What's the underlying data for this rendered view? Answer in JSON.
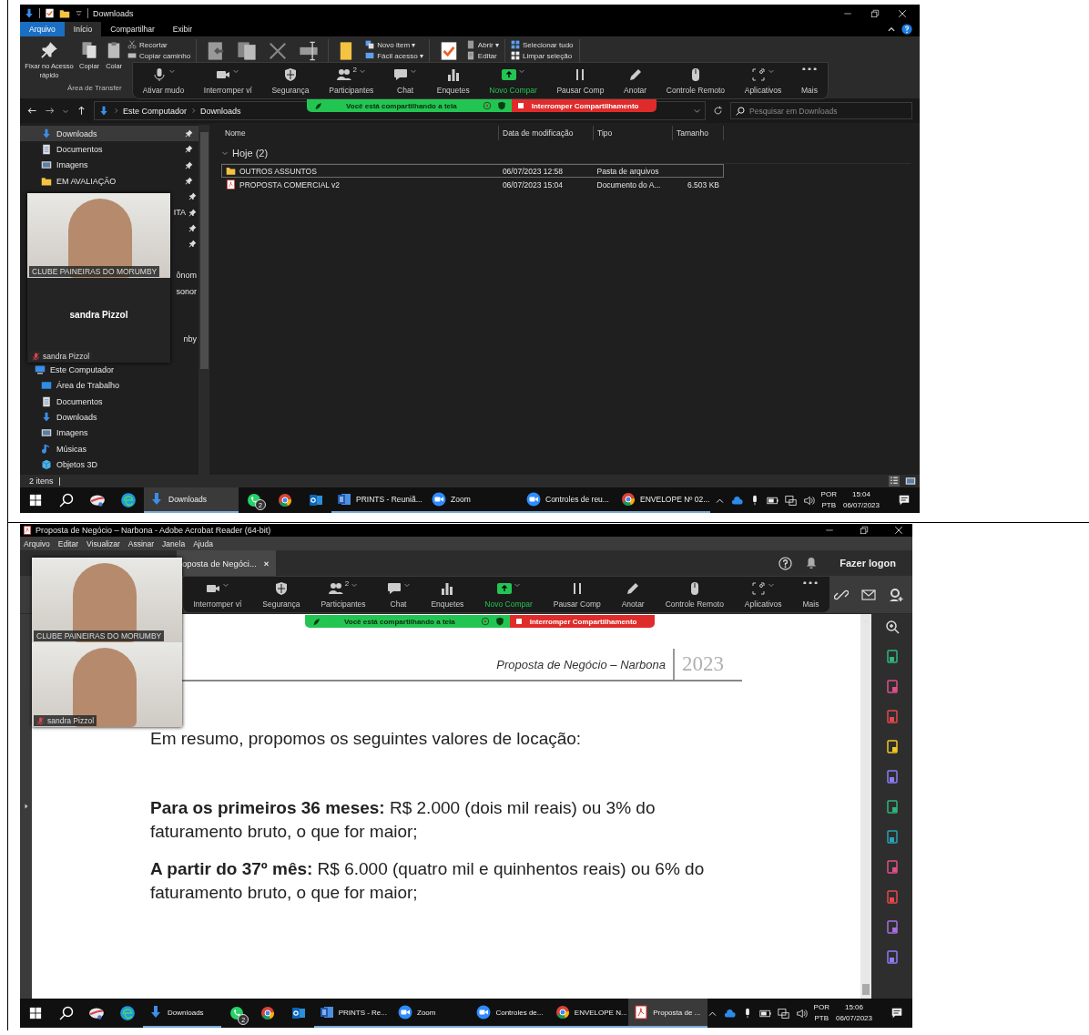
{
  "explorer": {
    "title": "Downloads",
    "ribbon": {
      "tabs": [
        {
          "label": "Arquivo",
          "kind": "file",
          "selected": false
        },
        {
          "label": "Início",
          "kind": "tab",
          "selected": true
        },
        {
          "label": "Compartilhar",
          "kind": "tab",
          "selected": false
        },
        {
          "label": "Exibir",
          "kind": "tab",
          "selected": false
        }
      ],
      "sections": [
        {
          "large": [
            {
              "kind": "pin",
              "label": "Fixar no Acesso rápido"
            },
            {
              "kind": "copy",
              "label": "Copiar"
            },
            {
              "kind": "paste",
              "label": "Colar"
            }
          ],
          "small": [
            {
              "kind": "cut",
              "label": "Recortar"
            },
            {
              "kind": "copy_path",
              "label": "Copiar caminho"
            }
          ],
          "label": "Área de Transfer"
        },
        {
          "large": [
            {
              "kind": "move"
            },
            {
              "kind": "copy_to"
            },
            {
              "kind": "delete"
            },
            {
              "kind": "rename"
            }
          ]
        },
        {
          "large": [
            {
              "kind": "new_folder"
            }
          ],
          "small": [
            {
              "kind": "new_item",
              "label": "Novo item ▾"
            },
            {
              "kind": "easy_access",
              "label": "Fácil acesso ▾"
            }
          ]
        },
        {
          "large": [
            {
              "kind": "properties"
            }
          ],
          "small": [
            {
              "kind": "open",
              "label": "Abrir ▾"
            },
            {
              "kind": "edit",
              "label": "Editar"
            }
          ]
        },
        {
          "small": [
            {
              "kind": "select_all",
              "label": "Selecionar tudo"
            },
            {
              "kind": "clear_selection",
              "label": "Limpar seleção"
            }
          ]
        }
      ]
    },
    "zoom_toolbar": [
      {
        "kind": "mic",
        "label": "Ativar mudo",
        "caret": true,
        "highlighted": false
      },
      {
        "kind": "video",
        "label": "Interromper ví",
        "caret": true,
        "highlighted": false
      },
      {
        "kind": "security",
        "label": "Segurança",
        "caret": false,
        "highlighted": false
      },
      {
        "kind": "participants",
        "label": "Participantes",
        "count": "2",
        "caret": true,
        "highlighted": false
      },
      {
        "kind": "chat",
        "label": "Chat",
        "caret": true,
        "highlighted": false
      },
      {
        "kind": "polls",
        "label": "Enquetes",
        "caret": false,
        "highlighted": false
      },
      {
        "kind": "share",
        "label": "Novo Compar",
        "caret": true,
        "highlighted": true
      },
      {
        "kind": "pause",
        "label": "Pausar Comp",
        "caret": false,
        "highlighted": false
      },
      {
        "kind": "annotate",
        "label": "Anotar",
        "caret": false,
        "highlighted": false
      },
      {
        "kind": "remote",
        "label": "Controle Remoto",
        "caret": false,
        "highlighted": false
      },
      {
        "kind": "apps",
        "label": "Aplicativos",
        "caret": true,
        "highlighted": false
      },
      {
        "kind": "more",
        "label": "Mais",
        "caret": false,
        "highlighted": false
      }
    ],
    "share_banner": {
      "message": "Você está compartilhando a tela",
      "stop": "Interromper Compartilhamento"
    },
    "address": {
      "path": [
        "Este Computador",
        "Downloads"
      ],
      "search_placeholder": "Pesquisar em Downloads"
    },
    "nav": {
      "quick_access": [
        {
          "kind": "download",
          "label": "Downloads",
          "pinned": true,
          "selected": true
        },
        {
          "kind": "document",
          "label": "Documentos",
          "pinned": true,
          "selected": false
        },
        {
          "kind": "image",
          "label": "Imagens",
          "pinned": true,
          "selected": false
        },
        {
          "kind": "folder",
          "label": "EM AVALIAÇÃO",
          "pinned": true,
          "selected": false
        },
        {
          "kind": "covered",
          "pinned": true,
          "selected": false
        },
        {
          "kind": "covered",
          "label": "ITA",
          "pinned": true,
          "selected": false
        },
        {
          "kind": "covered",
          "pinned": true,
          "selected": false
        },
        {
          "kind": "covered",
          "pinned": true,
          "selected": false
        },
        {
          "kind": "covered",
          "pinned": false,
          "selected": false
        },
        {
          "kind": "covered",
          "label": "ônom",
          "pinned": false,
          "selected": false
        },
        {
          "kind": "covered",
          "label": "sonor",
          "pinned": false,
          "selected": false
        },
        {
          "kind": "covered",
          "pinned": false,
          "selected": false
        },
        {
          "kind": "covered",
          "pinned": false,
          "selected": false
        },
        {
          "kind": "covered",
          "label": "nby",
          "pinned": false,
          "selected": false
        },
        {
          "kind": "covered",
          "pinned": false,
          "selected": false
        }
      ],
      "this_pc": {
        "kind": "pc",
        "label": "Este Computador",
        "selected": false,
        "children": [
          {
            "kind": "desktop",
            "label": "Área de Trabalho",
            "selected": false
          },
          {
            "kind": "document",
            "label": "Documentos",
            "selected": false
          },
          {
            "kind": "download",
            "label": "Downloads",
            "selected": false
          },
          {
            "kind": "image",
            "label": "Imagens",
            "selected": false
          },
          {
            "kind": "music",
            "label": "Músicas",
            "selected": false
          },
          {
            "kind": "objects3d",
            "label": "Objetos 3D",
            "selected": false
          }
        ]
      }
    },
    "video_panel": [
      {
        "kind": "video",
        "caption": "CLUBE PAINEIRAS DO MORUMBY",
        "muted": false
      },
      {
        "kind": "avatar",
        "name": "sandra Pizzol",
        "caption": "sandra Pizzol",
        "muted": true
      }
    ],
    "files": {
      "columns": [
        "Nome",
        "Data de modificação",
        "Tipo",
        "Tamanho"
      ],
      "group": {
        "label": "Hoje (2)",
        "expanded": true
      },
      "rows": [
        {
          "kind": "folder",
          "name": "OUTROS ASSUNTOS",
          "modified": "06/07/2023 12:58",
          "type": "Pasta de arquivos",
          "selected": true
        },
        {
          "kind": "pdf",
          "name": "PROPOSTA COMERCIAL v2",
          "modified": "06/07/2023 15:04",
          "type": "Documento do A...",
          "size": "6.503 KB",
          "selected": false
        }
      ]
    },
    "status_bar": "2 itens",
    "taskbar": {
      "apps": [
        {
          "kind": "explorer",
          "label": "Downloads",
          "active": true
        },
        {
          "kind": "whatsapp",
          "badge": "2",
          "active": false
        },
        {
          "kind": "chrome",
          "active": false
        },
        {
          "kind": "outlook",
          "active": false
        },
        {
          "kind": "word",
          "label": "PRINTS - Reuniã...",
          "active": false
        },
        {
          "kind": "zoom",
          "label": "Zoom",
          "active": false
        },
        {
          "kind": "zoom",
          "label": "Controles de reu...",
          "active": false
        },
        {
          "kind": "chrome",
          "label": "ENVELOPE Nº 02...",
          "active": false
        }
      ],
      "language": [
        "POR",
        "PTB"
      ],
      "time": "15:04",
      "date": "06/07/2023"
    }
  },
  "acrobat": {
    "title": "Proposta de Negócio – Narbona - Adobe Acrobat Reader (64-bit)",
    "menu": [
      "Arquivo",
      "Editar",
      "Visualizar",
      "Assinar",
      "Janela",
      "Ajuda"
    ],
    "tab": {
      "label": "oposta de Negóci...",
      "close": "×"
    },
    "sign_in": "Fazer logon",
    "zoom_toolbar": [
      {
        "kind": "video",
        "label": "Interromper ví",
        "caret": true,
        "highlighted": false
      },
      {
        "kind": "security",
        "label": "Segurança",
        "caret": false,
        "highlighted": false
      },
      {
        "kind": "participants",
        "label": "Participantes",
        "count": "2",
        "caret": true,
        "highlighted": false
      },
      {
        "kind": "chat",
        "label": "Chat",
        "caret": true,
        "highlighted": false
      },
      {
        "kind": "polls",
        "label": "Enquetes",
        "caret": false,
        "highlighted": false
      },
      {
        "kind": "share",
        "label": "Novo Compar",
        "caret": true,
        "highlighted": true
      },
      {
        "kind": "pause",
        "label": "Pausar Comp",
        "caret": false,
        "highlighted": false
      },
      {
        "kind": "annotate",
        "label": "Anotar",
        "caret": false,
        "highlighted": false
      },
      {
        "kind": "remote",
        "label": "Controle Remoto",
        "caret": false,
        "highlighted": false
      },
      {
        "kind": "apps",
        "label": "Aplicativos",
        "caret": true,
        "highlighted": false
      },
      {
        "kind": "more",
        "label": "Mais",
        "caret": false,
        "highlighted": false
      }
    ],
    "share_banner": {
      "message": "Você está compartilhando a tela",
      "stop": "Interromper Compartilhamento"
    },
    "video_panel": [
      {
        "kind": "video",
        "caption": "CLUBE PAINEIRAS DO MORUMBY",
        "muted": false
      },
      {
        "kind": "video",
        "caption": "sandra Pizzol",
        "muted": true
      }
    ],
    "document": {
      "header": "Proposta de Negócio – Narbona",
      "year": "2023",
      "paragraphs": [
        "Em resumo, propomos os seguintes valores de locação:",
        "**Para os primeiros 36 meses:** R$ 2.000 (dois mil reais) ou 3% do faturamento bruto, o que for maior;",
        "**A partir do 37º mês:** R$ 6.000 (quatro mil e quinhentos reais) ou 6% do faturamento bruto, o que for maior;"
      ]
    },
    "taskbar": {
      "apps": [
        {
          "kind": "explorer",
          "label": "Downloads",
          "active": false
        },
        {
          "kind": "whatsapp",
          "badge": "2",
          "active": false
        },
        {
          "kind": "chrome",
          "active": false
        },
        {
          "kind": "outlook",
          "active": false
        },
        {
          "kind": "word",
          "label": "PRINTS - Re...",
          "active": false
        },
        {
          "kind": "zoom",
          "label": "Zoom",
          "active": false
        },
        {
          "kind": "zoom",
          "label": "Controles de...",
          "active": false
        },
        {
          "kind": "chrome",
          "label": "ENVELOPE N...",
          "active": false
        },
        {
          "kind": "acrobat",
          "label": "Proposta de ...",
          "active": true
        }
      ],
      "language": [
        "POR",
        "PTB"
      ],
      "time": "15:06",
      "date": "06/07/2023"
    }
  }
}
